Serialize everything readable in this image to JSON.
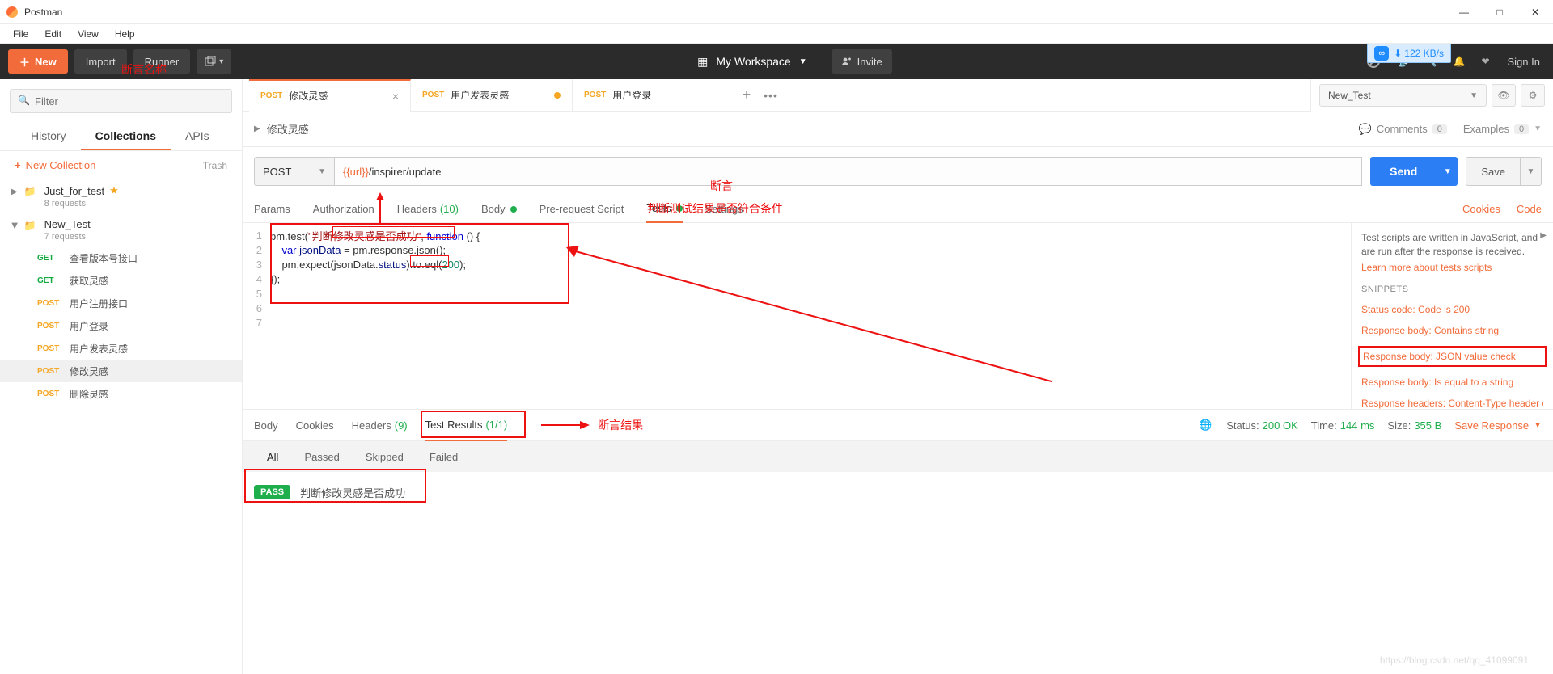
{
  "os": {
    "title": "Postman",
    "min": "—",
    "max": "□",
    "close": "✕"
  },
  "menu": [
    "File",
    "Edit",
    "View",
    "Help"
  ],
  "header": {
    "new": "New",
    "import": "Import",
    "runner": "Runner",
    "workspace": "My Workspace",
    "invite": "Invite",
    "signin": "Sign In",
    "speed": "122 KB/s"
  },
  "sidebar": {
    "filter_placeholder": "Filter",
    "tabs": [
      "History",
      "Collections",
      "APIs"
    ],
    "active_tab": 1,
    "new_collection": "New Collection",
    "trash": "Trash",
    "folders": [
      {
        "name": "Just_for_test",
        "sub": "8 requests",
        "starred": true,
        "open": false
      },
      {
        "name": "New_Test",
        "sub": "7 requests",
        "starred": false,
        "open": true
      }
    ],
    "requests": [
      {
        "method": "GET",
        "name": "查看版本号接口",
        "active": false
      },
      {
        "method": "GET",
        "name": "获取灵感",
        "active": false
      },
      {
        "method": "POST",
        "name": "用户注册接口",
        "active": false
      },
      {
        "method": "POST",
        "name": "用户登录",
        "active": false
      },
      {
        "method": "POST",
        "name": "用户发表灵感",
        "active": false
      },
      {
        "method": "POST",
        "name": "修改灵感",
        "active": true
      },
      {
        "method": "POST",
        "name": "删除灵感",
        "active": false
      }
    ]
  },
  "tabs": [
    {
      "method": "POST",
      "name": "修改灵感",
      "state": "active"
    },
    {
      "method": "POST",
      "name": "用户发表灵感",
      "state": "dirty"
    },
    {
      "method": "POST",
      "name": "用户登录",
      "state": "clean"
    }
  ],
  "env": {
    "selected": "New_Test",
    "breadcrumb": "修改灵感",
    "comments": "Comments",
    "comments_count": "0",
    "examples": "Examples",
    "examples_count": "0"
  },
  "urlbar": {
    "method": "POST",
    "var": "{{url}}",
    "path": "/inspirer/update",
    "send": "Send",
    "save": "Save"
  },
  "reqtabs": {
    "params": "Params",
    "auth": "Authorization",
    "headers": "Headers",
    "headers_count": "(10)",
    "body": "Body",
    "prereq": "Pre-request Script",
    "tests": "Tests",
    "settings": "Settings",
    "cookies": "Cookies",
    "code": "Code"
  },
  "editor": {
    "lines": [
      "pm.test(\"判断修改灵感是否成功\", function () {",
      "    var jsonData = pm.response.json();",
      "    pm.expect(jsonData.status).to.eql(200);",
      "});",
      "",
      "",
      ""
    ]
  },
  "tips": {
    "desc": "Test scripts are written in JavaScript, and are run after the response is received.",
    "learn": "Learn more about tests scripts",
    "hdr": "SNIPPETS",
    "snips": [
      "Status code: Code is 200",
      "Response body: Contains string",
      "Response body: JSON value check",
      "Response body: Is equal to a string",
      "Response headers: Content-Type header check"
    ]
  },
  "annotations": {
    "assert_name": "断言名称",
    "assert_label": "断言",
    "assert_desc": "判断测试结果是否符合条件",
    "assert_result": "断言结果"
  },
  "response": {
    "tabs": {
      "body": "Body",
      "cookies": "Cookies",
      "headers": "Headers",
      "headers_count": "(9)",
      "testresults": "Test Results",
      "tr_count": "(1/1)"
    },
    "status_lbl": "Status:",
    "status_val": "200 OK",
    "time_lbl": "Time:",
    "time_val": "144 ms",
    "size_lbl": "Size:",
    "size_val": "355 B",
    "save": "Save Response",
    "filters": [
      "All",
      "Passed",
      "Skipped",
      "Failed"
    ],
    "pass_badge": "PASS",
    "pass_name": "判断修改灵感是否成功"
  },
  "watermark": "https://blog.csdn.net/qq_41099091"
}
